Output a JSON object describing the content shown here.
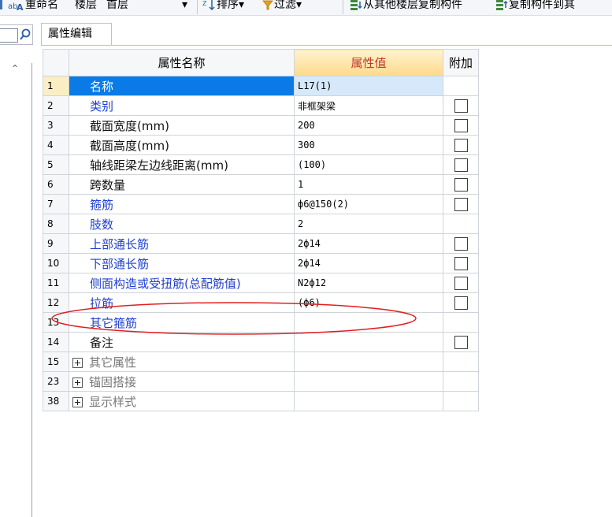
{
  "toolbar": {
    "rename_label": "重命名",
    "floor_label": "楼层",
    "floor_value": "首层",
    "sort_label": "排序",
    "filter_label": "过滤",
    "copy_from_label": "从其他楼层复制构件",
    "copy_to_label": "复制构件到其"
  },
  "tab": {
    "label": "属性编辑"
  },
  "grid": {
    "header": {
      "name": "属性名称",
      "value": "属性值",
      "extra": "附加"
    },
    "rows": [
      {
        "num": "1",
        "name": "名称",
        "value": "L17(1)",
        "color": "blue",
        "checkbox": false,
        "selected": true
      },
      {
        "num": "2",
        "name": "类别",
        "value": "非框架梁",
        "color": "blue",
        "checkbox": true
      },
      {
        "num": "3",
        "name": "截面宽度(mm)",
        "value": "200",
        "color": "black",
        "checkbox": true
      },
      {
        "num": "4",
        "name": "截面高度(mm)",
        "value": "300",
        "color": "black",
        "checkbox": true
      },
      {
        "num": "5",
        "name": "轴线距梁左边线距离(mm)",
        "value": "(100)",
        "color": "black",
        "checkbox": true
      },
      {
        "num": "6",
        "name": "跨数量",
        "value": "1",
        "color": "black",
        "checkbox": true
      },
      {
        "num": "7",
        "name": "箍筋",
        "value": "ф6@150(2)",
        "color": "blue",
        "checkbox": true
      },
      {
        "num": "8",
        "name": "肢数",
        "value": "2",
        "color": "blue",
        "checkbox": false
      },
      {
        "num": "9",
        "name": "上部通长筋",
        "value": "2ф14",
        "color": "blue",
        "checkbox": true
      },
      {
        "num": "10",
        "name": "下部通长筋",
        "value": "2ф14",
        "color": "blue",
        "checkbox": true
      },
      {
        "num": "11",
        "name": "侧面构造或受扭筋(总配筋值)",
        "value": "N2ф12",
        "color": "blue",
        "checkbox": true
      },
      {
        "num": "12",
        "name": "拉筋",
        "value": "(ф6)",
        "color": "blue",
        "checkbox": true
      },
      {
        "num": "13",
        "name": "其它箍筋",
        "value": "",
        "color": "blue",
        "checkbox": false
      },
      {
        "num": "14",
        "name": "备注",
        "value": "",
        "color": "black",
        "checkbox": true
      }
    ],
    "groups": [
      {
        "num": "15",
        "name": "其它属性"
      },
      {
        "num": "23",
        "name": "锚固搭接"
      },
      {
        "num": "38",
        "name": "显示样式"
      }
    ]
  },
  "colors": {
    "name_blue": "#1f3fd0",
    "selection_blue": "#0a7be6",
    "header_value_text": "#c0392b",
    "annotation_red": "#e02020"
  },
  "icons": [
    "rename-icon",
    "sort-icon",
    "filter-icon",
    "copy-from-floor-icon",
    "copy-to-floor-icon",
    "search-icon",
    "collapse-up-icon",
    "expand-plus-icon"
  ]
}
